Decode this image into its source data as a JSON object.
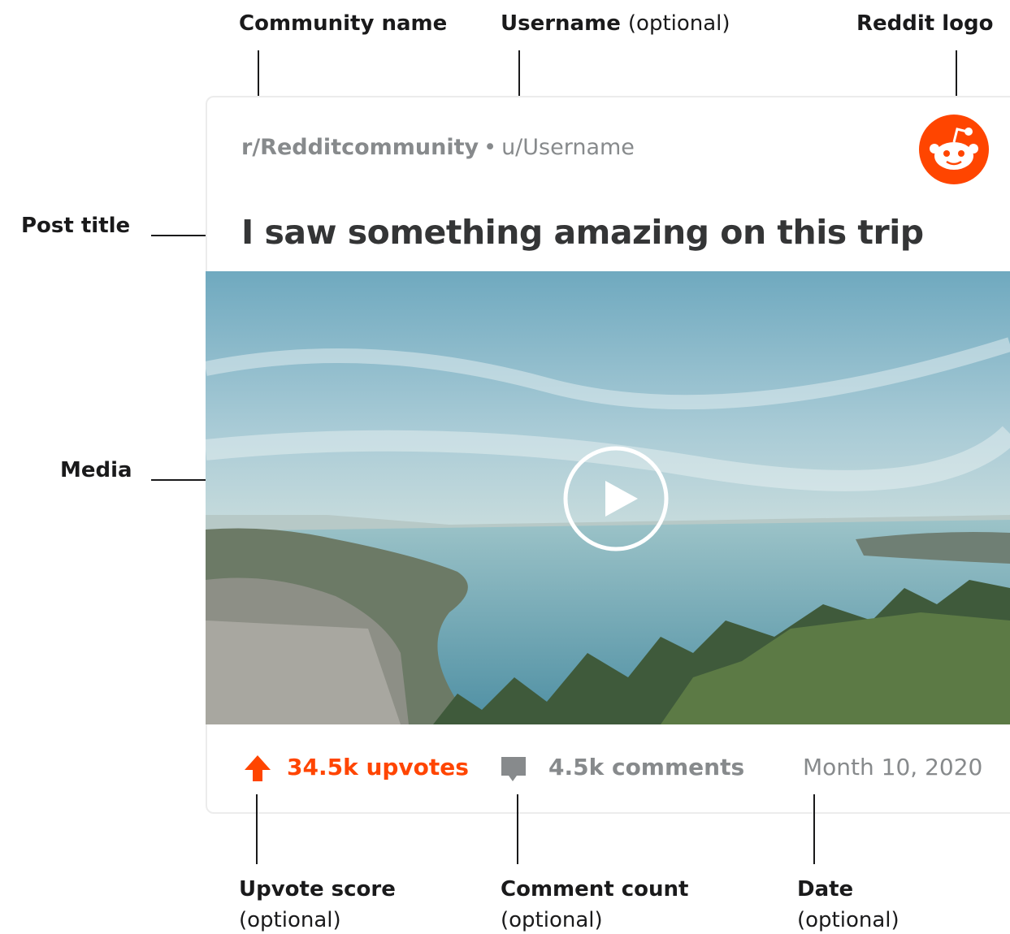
{
  "callouts": {
    "community_name": "Community name",
    "username": "Username",
    "username_optional": "(optional)",
    "reddit_logo": "Reddit logo",
    "post_title": "Post title",
    "media": "Media",
    "upvote_score": "Upvote score",
    "upvote_optional": "(optional)",
    "comment_count": "Comment count",
    "comment_optional": "(optional)",
    "date": "Date",
    "date_optional": "(optional)"
  },
  "post": {
    "community": "r/Redditcommunity",
    "separator": "•",
    "username": "u/Username",
    "title": "I saw something amazing on this trip",
    "upvotes": "34.5k upvotes",
    "comments": "4.5k comments",
    "date": "Month 10, 2020"
  },
  "colors": {
    "accent": "#ff4500",
    "meta_gray": "#878a8c",
    "title": "#343536"
  },
  "icons": {
    "logo": "reddit-snoo-icon",
    "upvote": "upvote-arrow-icon",
    "comment": "comment-bubble-icon",
    "play": "play-icon"
  }
}
